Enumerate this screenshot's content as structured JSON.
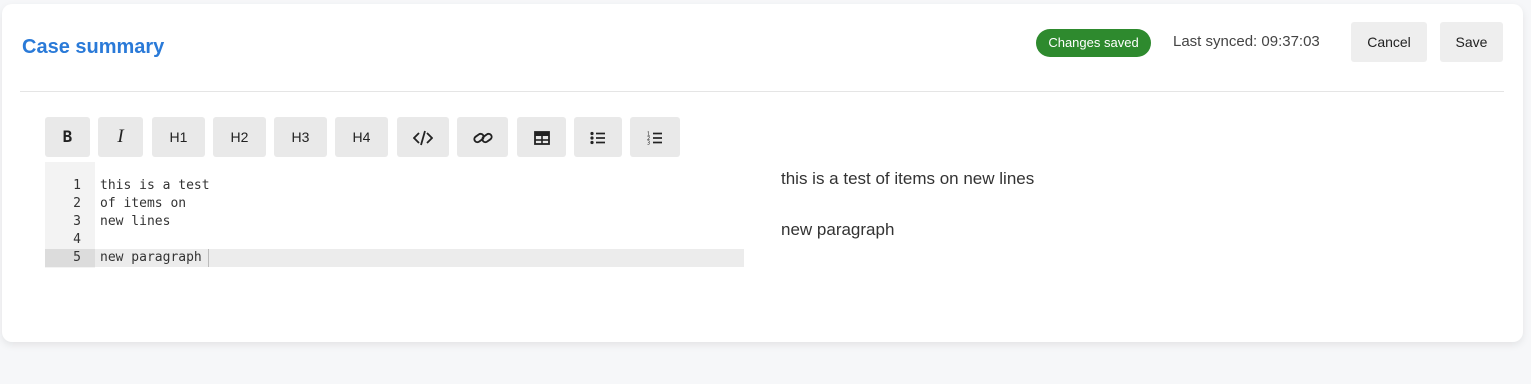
{
  "header": {
    "title": "Case summary",
    "status_badge": "Changes saved",
    "last_synced": "Last synced: 09:37:03",
    "cancel_label": "Cancel",
    "save_label": "Save"
  },
  "colors": {
    "title": "#2a7ad8",
    "badge": "#2e8a2e"
  },
  "toolbar": {
    "bold_label": "B",
    "italic_label": "I",
    "h1_label": "H1",
    "h2_label": "H2",
    "h3_label": "H3",
    "h4_label": "H4",
    "icons": [
      "code-icon",
      "link-icon",
      "table-icon",
      "bullet-list-icon",
      "numbered-list-icon"
    ]
  },
  "editor": {
    "lines": [
      {
        "num": "1",
        "text": "this is a test"
      },
      {
        "num": "2",
        "text": "of items on"
      },
      {
        "num": "3",
        "text": "new lines"
      },
      {
        "num": "4",
        "text": ""
      },
      {
        "num": "5",
        "text": "new paragraph"
      }
    ],
    "active_line": 5
  },
  "preview": {
    "paragraphs": [
      "this is a test of items on new lines",
      "new paragraph"
    ]
  }
}
